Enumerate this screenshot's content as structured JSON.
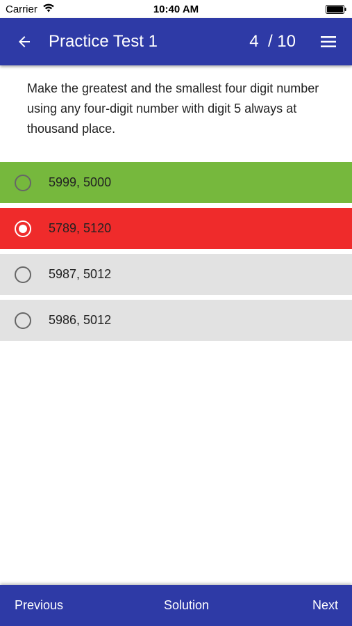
{
  "status_bar": {
    "carrier": "Carrier",
    "time": "10:40 AM",
    "icons": [
      "wifi-icon",
      "battery-icon"
    ]
  },
  "app_bar": {
    "title": "Practice Test 1",
    "progress": "4  / 10",
    "back_icon": "arrow-left-icon",
    "menu_icon": "hamburger-menu-icon",
    "color": "#2e3aa6"
  },
  "question": {
    "text": "Make the greatest and the smallest four digit number using any four-digit number with digit 5 always at thousand place."
  },
  "options": [
    {
      "label": "5999, 5000",
      "state": "correct",
      "selected": false,
      "color": "#76b83d"
    },
    {
      "label": "5789, 5120",
      "state": "wrong",
      "selected": true,
      "color": "#ef2b2b"
    },
    {
      "label": "5987, 5012",
      "state": "neutral",
      "selected": false,
      "color": "#e2e2e2"
    },
    {
      "label": "5986, 5012",
      "state": "neutral",
      "selected": false,
      "color": "#e2e2e2"
    }
  ],
  "bottom_bar": {
    "previous": "Previous",
    "solution": "Solution",
    "next": "Next"
  }
}
